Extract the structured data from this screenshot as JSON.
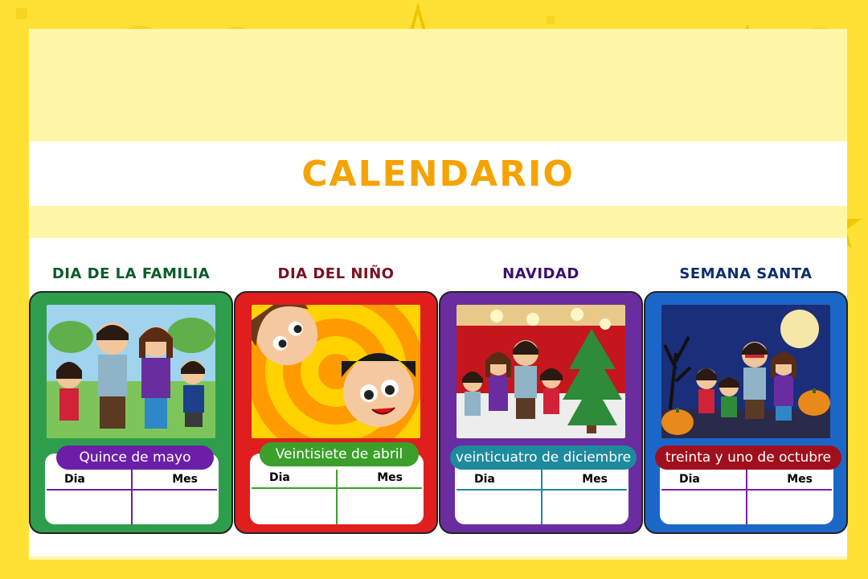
{
  "page": {
    "title": "CALENDARIO"
  },
  "cards": [
    {
      "title": "DIA DE LA FAMILIA",
      "date": "Quince de mayo",
      "col_day": "Dia",
      "col_month": "Mes",
      "colors": {
        "title": "#0B5C2A",
        "box": "#2E9E4D",
        "pill": "#6B1FA8",
        "line": "#6B1FA8"
      },
      "scene": "family-park"
    },
    {
      "title": "DIA DEL NIÑO",
      "date": "Veintisiete de abril",
      "col_day": "Dia",
      "col_month": "Mes",
      "colors": {
        "title": "#7A1020",
        "box": "#E01E1E",
        "pill": "#3BA02A",
        "line": "#3BA02A"
      },
      "scene": "kids-spiral"
    },
    {
      "title": "NAVIDAD",
      "date": "veinticuatro de diciembre",
      "col_day": "Dia",
      "col_month": "Mes",
      "colors": {
        "title": "#3D1070",
        "box": "#6A2DA0",
        "pill": "#1E8A9E",
        "line": "#1E8A9E"
      },
      "scene": "christmas-tree"
    },
    {
      "title": "SEMANA SANTA",
      "date": "treinta y uno de octubre",
      "col_day": "Dia",
      "col_month": "Mes",
      "colors": {
        "title": "#0E2E6E",
        "box": "#1A67C8",
        "pill": "#A0101C",
        "line": "#7A1FA8"
      },
      "scene": "halloween-night"
    }
  ]
}
